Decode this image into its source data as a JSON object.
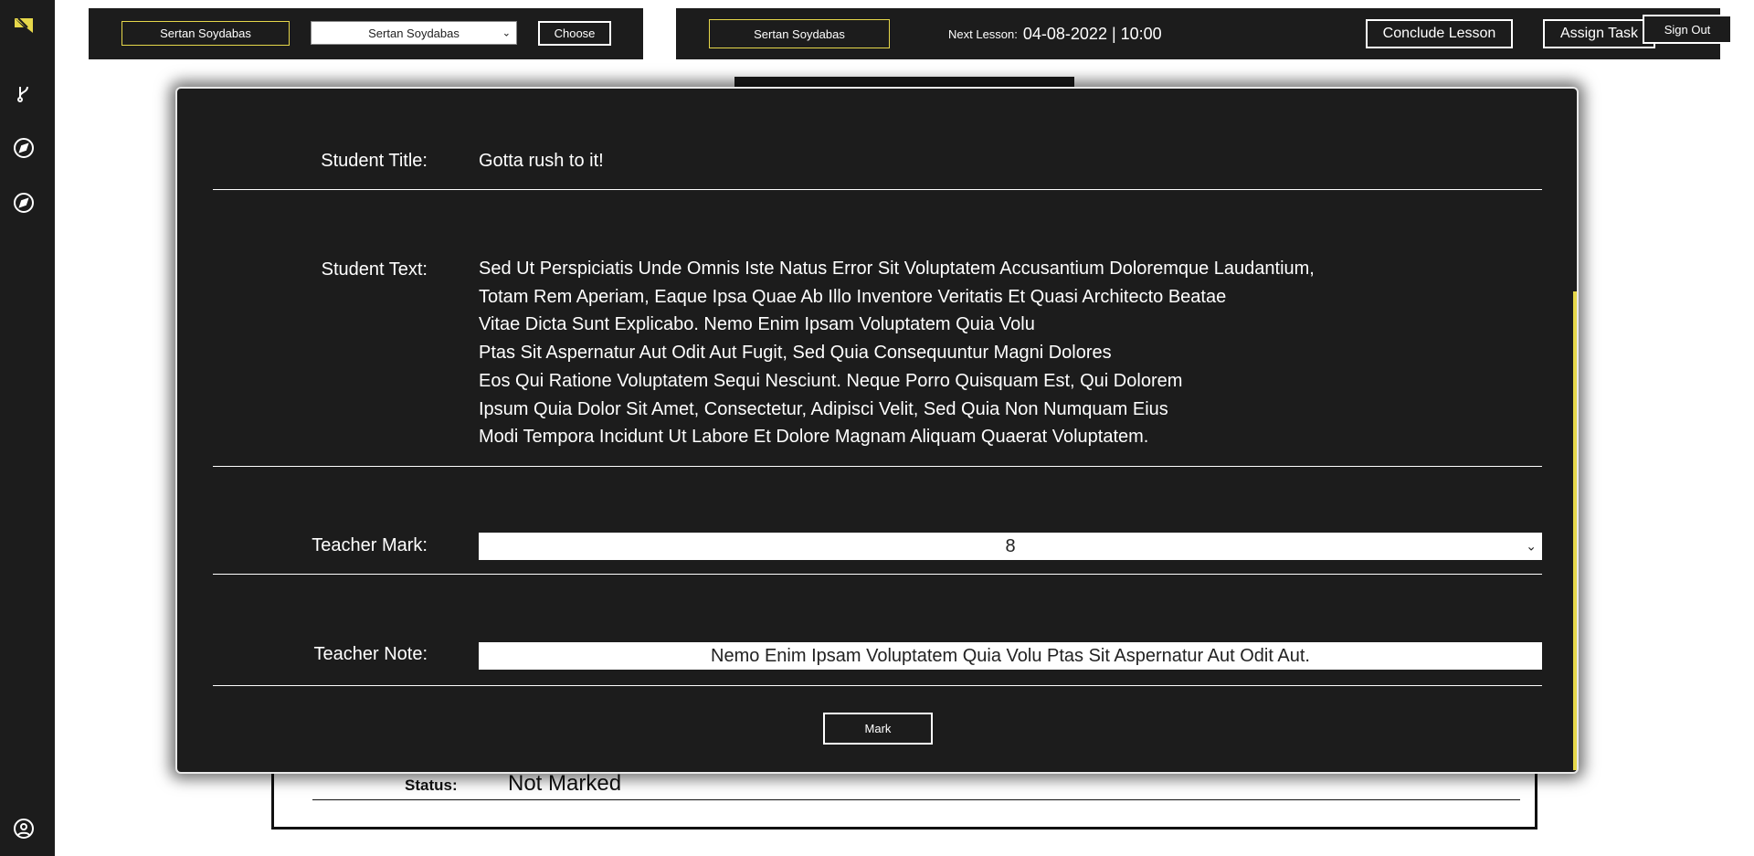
{
  "sidebar": {
    "icons": [
      "logo-icon",
      "branch-icon",
      "compass-icon",
      "compass-icon",
      "user-circle-icon"
    ]
  },
  "left_bar": {
    "name_box": "Sertan Soydabas",
    "select_value": "Sertan Soydabas",
    "choose_button": "Choose"
  },
  "right_bar": {
    "name_box": "Sertan Soydabas",
    "next_lesson_label": "Next Lesson:",
    "next_lesson_value": "04-08-2022 | 10:00",
    "conclude_button": "Conclude Lesson",
    "assign_button": "Assign Task",
    "signout_button": "Sign Out"
  },
  "background_card": {
    "status_label": "Status:",
    "status_value": "Not Marked"
  },
  "modal": {
    "student_title_label": "Student Title:",
    "student_title_value": "Gotta rush to it!",
    "student_text_label": "Student Text:",
    "student_text_lines": [
      "Sed Ut Perspiciatis Unde Omnis Iste Natus Error Sit Voluptatem Accusantium Doloremque Laudantium,",
      "Totam Rem Aperiam, Eaque Ipsa Quae Ab Illo Inventore Veritatis Et Quasi Architecto Beatae",
      "Vitae Dicta Sunt Explicabo. Nemo Enim Ipsam Voluptatem Quia Volu",
      "Ptas Sit Aspernatur Aut Odit Aut Fugit, Sed Quia Consequuntur Magni Dolores",
      "Eos Qui Ratione Voluptatem Sequi Nesciunt. Neque Porro Quisquam Est, Qui Dolorem",
      "Ipsum Quia Dolor Sit Amet, Consectetur, Adipisci Velit, Sed Quia Non Numquam Eius",
      "Modi Tempora Incidunt Ut Labore Et Dolore Magnam Aliquam Quaerat Voluptatem."
    ],
    "teacher_mark_label": "Teacher Mark:",
    "teacher_mark_value": "8",
    "teacher_note_label": "Teacher Note:",
    "teacher_note_value": "Nemo Enim Ipsam Voluptatem Quia Volu Ptas Sit Aspernatur Aut Odit Aut.",
    "mark_button": "Mark"
  },
  "colors": {
    "panel": "#1c1c1c",
    "accent": "#e6d74a",
    "text": "#ffffff"
  }
}
